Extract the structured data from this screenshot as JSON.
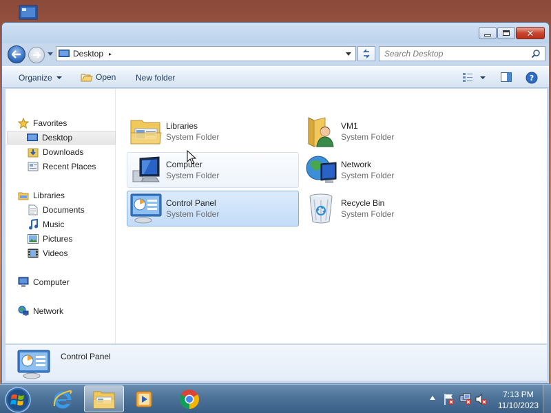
{
  "address": {
    "location": "Desktop",
    "chevron": "▸"
  },
  "search": {
    "placeholder": "Search Desktop"
  },
  "toolbar": {
    "organize": "Organize",
    "open": "Open",
    "new_folder": "New folder"
  },
  "sidebar": {
    "favorites": [
      {
        "label": "Favorites",
        "icon": "star-icon"
      },
      {
        "label": "Desktop",
        "icon": "desktop-icon",
        "selected": true
      },
      {
        "label": "Downloads",
        "icon": "downloads-icon"
      },
      {
        "label": "Recent Places",
        "icon": "recent-places-icon"
      }
    ],
    "libraries": [
      {
        "label": "Libraries",
        "icon": "libraries-icon"
      },
      {
        "label": "Documents",
        "icon": "documents-icon"
      },
      {
        "label": "Music",
        "icon": "music-icon"
      },
      {
        "label": "Pictures",
        "icon": "pictures-icon"
      },
      {
        "label": "Videos",
        "icon": "videos-icon"
      }
    ],
    "computer": {
      "label": "Computer",
      "icon": "computer-icon"
    },
    "network": {
      "label": "Network",
      "icon": "network-icon"
    }
  },
  "items": [
    {
      "name": "Libraries",
      "type": "System Folder",
      "icon": "libraries-folder-icon"
    },
    {
      "name": "VM1",
      "type": "System Folder",
      "icon": "user-folder-icon"
    },
    {
      "name": "Computer",
      "type": "System Folder",
      "icon": "computer-icon",
      "state": "hover"
    },
    {
      "name": "Network",
      "type": "System Folder",
      "icon": "network-globe-icon"
    },
    {
      "name": "Control Panel",
      "type": "System Folder",
      "icon": "control-panel-icon",
      "state": "selected"
    },
    {
      "name": "Recycle Bin",
      "type": "System Folder",
      "icon": "recycle-bin-icon"
    }
  ],
  "details": {
    "name": "Control Panel"
  },
  "taskbar": {
    "apps": [
      "internet-explorer-icon",
      "windows-explorer-icon",
      "media-player-icon",
      "chrome-icon"
    ],
    "active_app": "windows-explorer-icon"
  },
  "clock": {
    "time": "7:13 PM",
    "date": "11/10/2023"
  },
  "colors": {
    "selection": "#c3dcf8",
    "taskbar": "#4d7399",
    "titlebar": "#bcd2ec"
  }
}
